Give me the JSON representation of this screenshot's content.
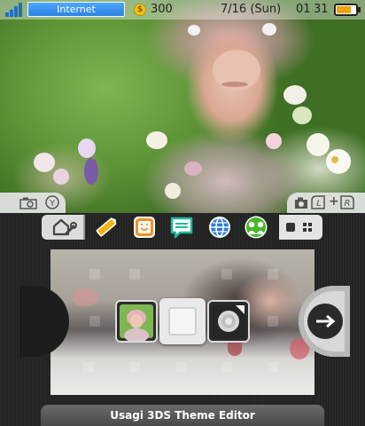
{
  "status_bar": {
    "network_label": "Internet",
    "play_coins": "300",
    "date": "7/16 (Sun)",
    "time_hours": "01",
    "time_minutes": "31",
    "battery_level": 0.75,
    "battery_color": "#f2a010",
    "network_color": "#2e82e0"
  },
  "top_buttons": {
    "left": {
      "icons": [
        "camera-icon",
        "y-button-icon"
      ],
      "button_label": "Y"
    },
    "right": {
      "icons": [
        "camera-icon",
        "l-button-icon",
        "plus-icon",
        "r-button-icon"
      ],
      "l_label": "L",
      "plus_label": "+",
      "r_label": "R"
    }
  },
  "toolbar": {
    "icons": [
      "home-settings-icon",
      "notes-icon",
      "miiverse-icon",
      "notifications-icon",
      "internet-browser-icon",
      "friend-list-icon",
      "view-toggle-icon"
    ],
    "colors": {
      "notes": "#f2b40a",
      "miiverse": "#f29222",
      "notifications": "#1fb99e",
      "browser": "#2a7ce0",
      "friends": "#47b82a"
    }
  },
  "shelf": {
    "slots": [
      "theme-thumbnail",
      "empty-slot",
      "rose-thumbnail"
    ]
  },
  "footer": {
    "title": "Usagi 3DS Theme Editor"
  }
}
